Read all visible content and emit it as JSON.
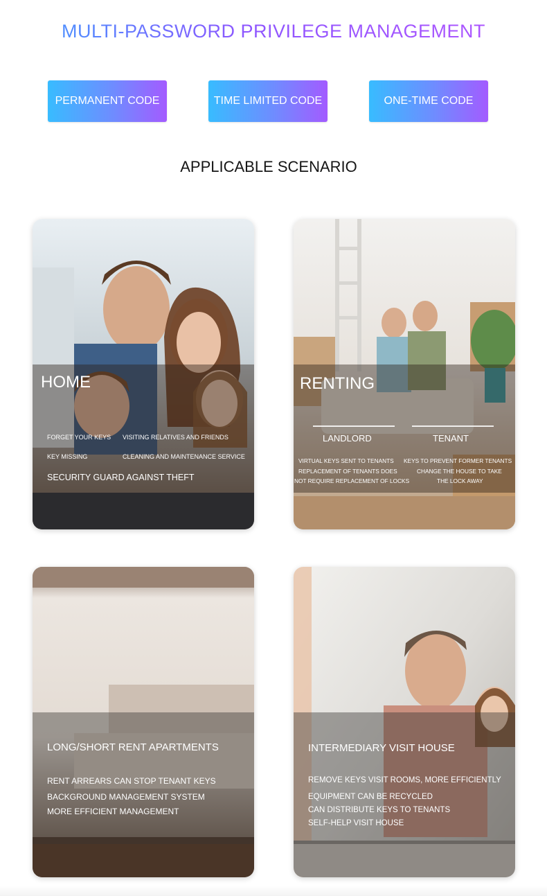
{
  "header": {
    "title": "MULTI-PASSWORD PRIVILEGE MANAGEMENT",
    "codes": [
      "PERMANENT CODE",
      "TIME LIMITED CODE",
      "ONE-TIME CODE"
    ],
    "subtitle": "APPLICABLE SCENARIO"
  },
  "cards": {
    "home": {
      "title": "HOME",
      "items": [
        "FORGET YOUR KEYS",
        "VISITING RELATIVES AND FRIENDS",
        "KEY MISSING",
        "CLEANING AND MAINTENANCE SERVICE"
      ],
      "footer": "SECURITY GUARD AGAINST THEFT"
    },
    "renting": {
      "title": "RENTING",
      "landlord": {
        "label": "LANDLORD",
        "lines": [
          "VIRTUAL KEYS SENT TO TENANTS",
          "REPLACEMENT OF TENANTS DOES",
          "NOT REQUIRE REPLACEMENT OF LOCKS"
        ]
      },
      "tenant": {
        "label": "TENANT",
        "lines": [
          "KEYS TO PREVENT FORMER TENANTS",
          "CHANGE THE HOUSE TO TAKE",
          "THE LOCK AWAY"
        ]
      }
    },
    "apartments": {
      "title": "LONG/SHORT RENT APARTMENTS",
      "lines": [
        "RENT ARREARS CAN STOP TENANT KEYS",
        "BACKGROUND MANAGEMENT SYSTEM",
        "MORE EFFICIENT MANAGEMENT"
      ]
    },
    "intermediary": {
      "title": "INTERMEDIARY VISIT HOUSE",
      "lines": [
        "REMOVE KEYS VISIT ROOMS, MORE EFFICIENTLY",
        "EQUIPMENT CAN BE RECYCLED",
        "CAN DISTRIBUTE KEYS TO TENANTS",
        "SELF-HELP VISIT HOUSE"
      ]
    }
  }
}
